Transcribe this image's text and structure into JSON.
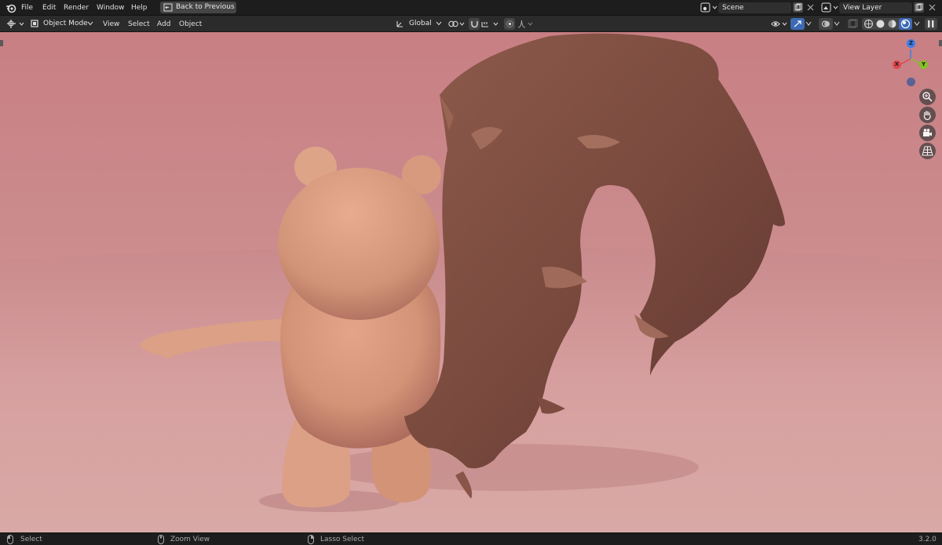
{
  "topbar": {
    "menus": [
      "File",
      "Edit",
      "Render",
      "Window",
      "Help"
    ],
    "back_button": "Back to Previous",
    "scene_field": "Scene",
    "view_layer_field": "View Layer"
  },
  "toolbar": {
    "mode": "Object Mode",
    "menus": [
      "View",
      "Select",
      "Add",
      "Object"
    ],
    "transform_orientation": "Global"
  },
  "gizmo": {
    "x": "X",
    "y": "Y",
    "z": "Z",
    "colors": {
      "x": "#e0484e",
      "y": "#83c227",
      "z": "#3a7ee8"
    }
  },
  "nav_buttons": [
    "zoom-icon",
    "hand-pan-icon",
    "camera-icon",
    "grid-perspective-icon"
  ],
  "statusbar": {
    "select": "Select",
    "zoom_view": "Zoom View",
    "lasso_select": "Lasso Select",
    "version": "3.2.0"
  }
}
